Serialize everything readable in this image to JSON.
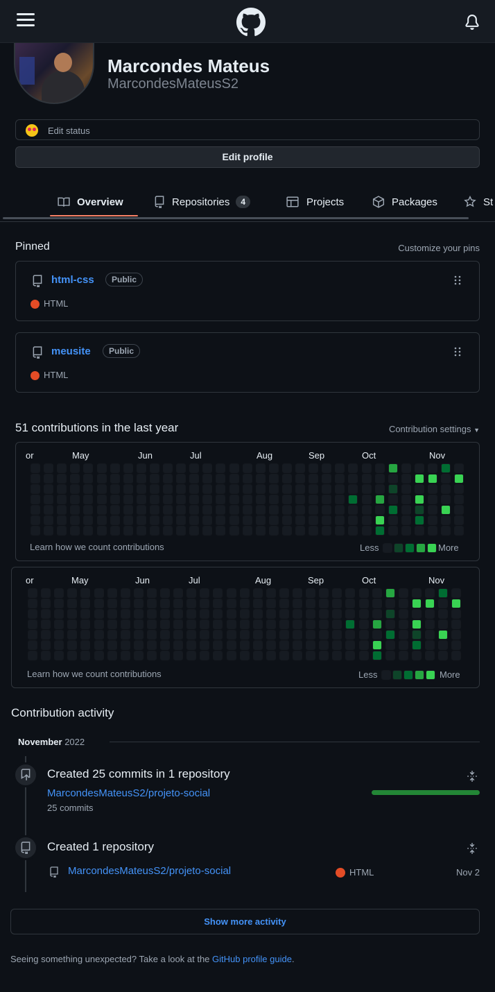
{
  "icons": {
    "menu": "hamburger-menu-icon",
    "logo": "github-octocat-logo",
    "bell": "bell-icon",
    "book": "book-icon",
    "repo": "repo-icon",
    "table": "table-icon",
    "package": "package-icon",
    "star": "star-icon",
    "grabber": "grabber-dots-icon",
    "caret": "triangle-down-icon",
    "fold": "fold-icon",
    "repo_push": "repo-push-icon"
  },
  "colors": {
    "background": "#0d1117",
    "link": "#4493f8",
    "tab_underline": "#f78166",
    "html_language": "#e34c26",
    "contribution_levels": [
      "#161b22",
      "#0e4429",
      "#006d32",
      "#26a641",
      "#39d353"
    ]
  },
  "profile": {
    "name": "Marcondes Mateus",
    "login": "MarcondesMateusS2",
    "status_text": "Edit status",
    "edit_profile_label": "Edit profile"
  },
  "tabs": [
    {
      "label": "Overview",
      "active": true
    },
    {
      "label": "Repositories",
      "count": "4"
    },
    {
      "label": "Projects"
    },
    {
      "label": "Packages"
    },
    {
      "label": "St"
    }
  ],
  "pinned": {
    "title": "Pinned",
    "customize_label": "Customize your pins",
    "repos": [
      {
        "name": "html-css",
        "visibility": "Public",
        "language": "HTML"
      },
      {
        "name": "meusite",
        "visibility": "Public",
        "language": "HTML"
      }
    ]
  },
  "contributions": {
    "title": "51 contributions in the last year",
    "settings_label": "Contribution settings",
    "months": [
      "or",
      "May",
      "Jun",
      "Jul",
      "Aug",
      "Sep",
      "Oct",
      "Nov"
    ],
    "learn_label": "Learn how we count contributions",
    "legend_less": "Less",
    "legend_more": "More",
    "week_levels": [
      [
        0,
        0,
        0,
        0,
        0,
        0,
        0
      ],
      [
        0,
        0,
        0,
        0,
        0,
        0,
        0
      ],
      [
        0,
        0,
        0,
        0,
        0,
        0,
        0
      ],
      [
        0,
        0,
        0,
        0,
        0,
        0,
        0
      ],
      [
        0,
        0,
        0,
        0,
        0,
        0,
        0
      ],
      [
        0,
        0,
        0,
        0,
        0,
        0,
        0
      ],
      [
        0,
        0,
        0,
        0,
        0,
        0,
        0
      ],
      [
        0,
        0,
        0,
        0,
        0,
        0,
        0
      ],
      [
        0,
        0,
        0,
        0,
        0,
        0,
        0
      ],
      [
        0,
        0,
        0,
        0,
        0,
        0,
        0
      ],
      [
        0,
        0,
        0,
        0,
        0,
        0,
        0
      ],
      [
        0,
        0,
        0,
        0,
        0,
        0,
        0
      ],
      [
        0,
        0,
        0,
        0,
        0,
        0,
        0
      ],
      [
        0,
        0,
        0,
        0,
        0,
        0,
        0
      ],
      [
        0,
        0,
        0,
        0,
        0,
        0,
        0
      ],
      [
        0,
        0,
        0,
        0,
        0,
        0,
        0
      ],
      [
        0,
        0,
        0,
        0,
        0,
        0,
        0
      ],
      [
        0,
        0,
        0,
        0,
        0,
        0,
        0
      ],
      [
        0,
        0,
        0,
        0,
        0,
        0,
        0
      ],
      [
        0,
        0,
        0,
        0,
        0,
        0,
        0
      ],
      [
        0,
        0,
        0,
        0,
        0,
        0,
        0
      ],
      [
        0,
        0,
        0,
        0,
        0,
        0,
        0
      ],
      [
        0,
        0,
        0,
        0,
        0,
        0,
        0
      ],
      [
        0,
        0,
        0,
        0,
        0,
        0,
        0
      ],
      [
        0,
        0,
        0,
        2,
        0,
        0,
        0
      ],
      [
        0,
        0,
        0,
        0,
        0,
        0,
        0
      ],
      [
        0,
        0,
        0,
        3,
        0,
        4,
        2
      ],
      [
        3,
        0,
        1,
        0,
        2,
        0,
        0
      ],
      [
        0,
        0,
        0,
        0,
        0,
        0,
        0
      ],
      [
        0,
        4,
        0,
        4,
        1,
        2,
        0
      ],
      [
        0,
        4,
        0,
        0,
        0,
        0,
        0
      ],
      [
        2,
        0,
        0,
        0,
        4,
        0,
        0
      ],
      [
        0,
        4,
        0,
        0,
        0,
        0,
        0
      ]
    ]
  },
  "activity": {
    "title": "Contribution activity",
    "month": "November",
    "year": "2022",
    "items": [
      {
        "heading": "Created 25 commits in 1 repository",
        "repo": "MarcondesMateusS2/projeto-social",
        "detail": "25 commits",
        "progress": 1.0
      },
      {
        "heading": "Created 1 repository",
        "repo": "MarcondesMateusS2/projeto-social",
        "language": "HTML",
        "date": "Nov 2"
      }
    ],
    "show_more_label": "Show more activity"
  },
  "footer": {
    "text": "Seeing something unexpected? Take a look at the",
    "link": "GitHub profile guide",
    "end": "."
  }
}
